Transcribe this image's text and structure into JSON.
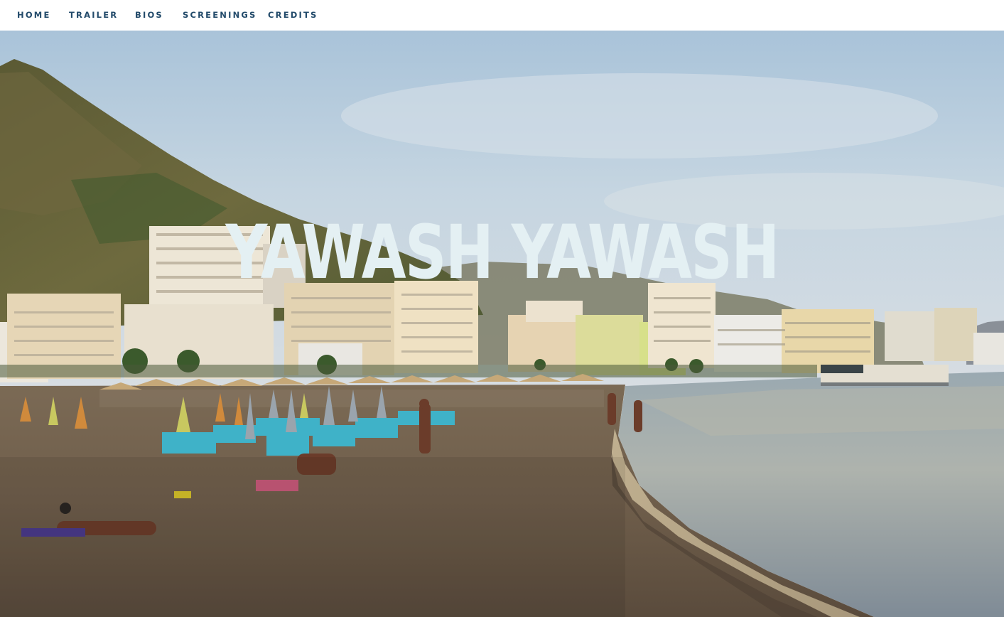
{
  "nav": {
    "items": [
      {
        "label": "HOME"
      },
      {
        "label": "TRAILER"
      },
      {
        "label": "BIOS"
      },
      {
        "label": "SCREENINGS"
      },
      {
        "label": "CREDITS"
      }
    ]
  },
  "hero": {
    "title": "YAWASH YAWASH",
    "image_subject": "beach-promenade-photo"
  },
  "colors": {
    "nav_text": "#224a6a",
    "title_text": "#e4f0f3",
    "header_bg": "#ffffff"
  }
}
